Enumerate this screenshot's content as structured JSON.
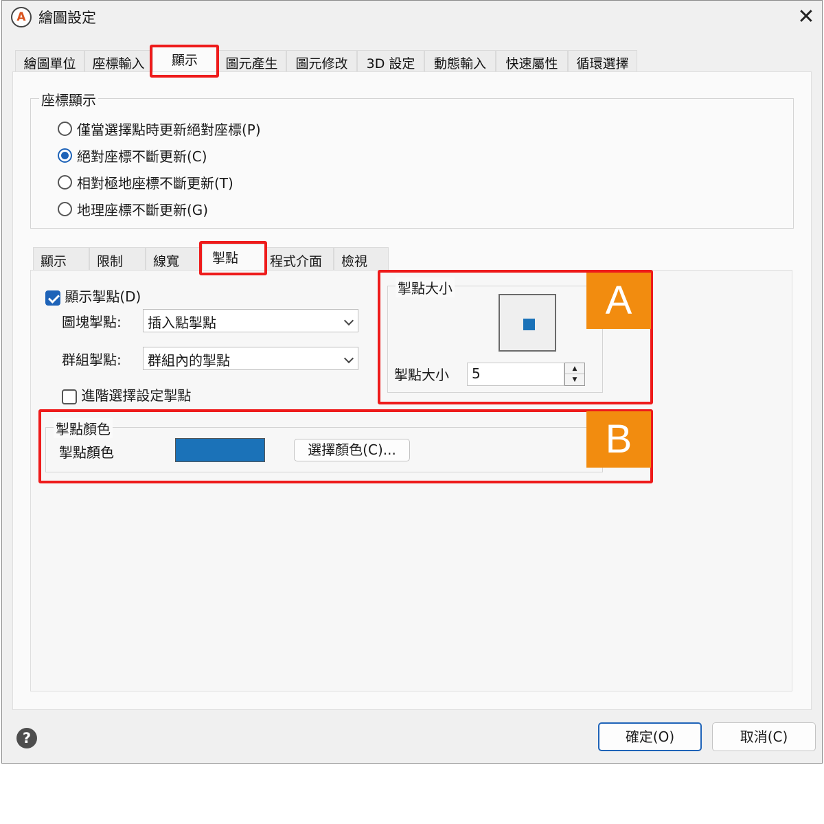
{
  "window": {
    "title": "繪圖設定",
    "app_icon_letter": "A",
    "close_glyph": "✕"
  },
  "tabs": [
    "繪圖單位",
    "座標輸入",
    "顯示",
    "圖元產生",
    "圖元修改",
    "3D 設定",
    "動態輸入",
    "快速屬性",
    "循環選擇"
  ],
  "coord_display": {
    "title": "座標顯示",
    "options": [
      "僅當選擇點時更新絕對座標(P)",
      "絕對座標不斷更新(C)",
      "相對極地座標不斷更新(T)",
      "地理座標不斷更新(G)"
    ],
    "selected_index": 1
  },
  "subtabs": [
    "顯示",
    "限制",
    "線寬",
    "掣點",
    "程式介面",
    "檢視"
  ],
  "grips": {
    "show_label": "顯示掣點(D)",
    "show_checked": true,
    "block_label": "圖塊掣點:",
    "block_value": "插入點掣點",
    "group_label": "群組掣點:",
    "group_value": "群組內的掣點",
    "advanced_label": "進階選擇設定掣點",
    "advanced_checked": false
  },
  "grip_size": {
    "title": "掣點大小",
    "label": "掣點大小",
    "value": "5",
    "spin_up": "▲",
    "spin_down": "▼"
  },
  "grip_color": {
    "title": "掣點顏色",
    "label": "掣點顏色",
    "swatch_color": "#1b72b8",
    "button": "選擇顏色(C)..."
  },
  "annotations": {
    "a": "A",
    "b": "B",
    "highlight_color": "#ee1b1b",
    "badge_color": "#f28c0f"
  },
  "footer": {
    "help_glyph": "?",
    "ok": "確定(O)",
    "cancel": "取消(C)"
  }
}
